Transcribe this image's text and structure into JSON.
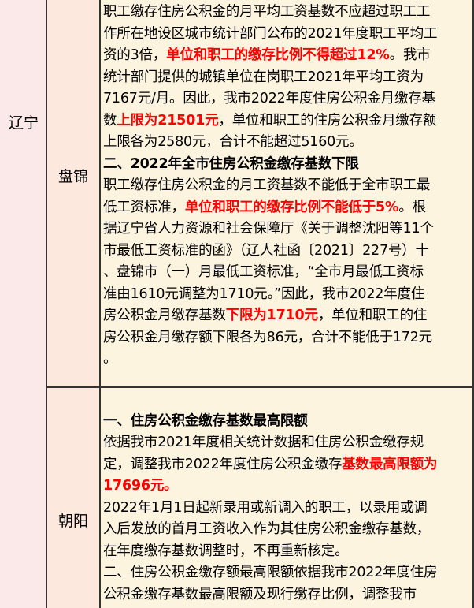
{
  "province": "辽宁",
  "rows": [
    {
      "city": "盘锦",
      "lines": [
        [
          {
            "t": "职工缴存住房公积金的月平均工资基数不应超过职工工"
          }
        ],
        [
          {
            "t": "作所在地设区城市统计部门公布的2021年度职工平均工"
          }
        ],
        [
          {
            "t": "资的3倍，"
          },
          {
            "t": "单位和职工的缴存比例不得超过12%",
            "s": "red"
          },
          {
            "t": "。我市"
          }
        ],
        [
          {
            "t": "统计部门提供的城镇单位在岗职工2021年平均工资为"
          }
        ],
        [
          {
            "t": "7167元/月。因此，我市2022年度住房公积金月缴存基"
          }
        ],
        [
          {
            "t": "数"
          },
          {
            "t": "上限为21501元",
            "s": "red"
          },
          {
            "t": "，单位和职工的住房公积金月缴存额"
          }
        ],
        [
          {
            "t": "上限各为2580元，合计不能超过5160元。"
          }
        ],
        [
          {
            "t": "二、2022年全市住房公积金缴存基数下限",
            "s": "b"
          }
        ],
        [
          {
            "t": "职工缴存住房公积金的月工资基数不能低于全市职工最"
          }
        ],
        [
          {
            "t": "低工资标准，"
          },
          {
            "t": "单位和职工的缴存比例不能低于5%",
            "s": "red"
          },
          {
            "t": "。根"
          }
        ],
        [
          {
            "t": "据辽宁省人力资源和社会保障厅《关于调整沈阳等11个"
          }
        ],
        [
          {
            "t": "市最低工资标准的函》（辽人社函〔2021〕227号）十"
          }
        ],
        [
          {
            "t": "、盘锦市（一）月最低工资标准，“全市月最低工资标"
          }
        ],
        [
          {
            "t": "准由1610元调整为1710元。”因此，我市2022年度住"
          }
        ],
        [
          {
            "t": "房公积金月缴存基数"
          },
          {
            "t": "下限为1710元",
            "s": "red"
          },
          {
            "t": "，单位和职工的住"
          }
        ],
        [
          {
            "t": "房公积金月缴存额下限各为86元，合计不能低于172元"
          }
        ],
        [
          {
            "t": "。"
          }
        ]
      ]
    },
    {
      "city": "朝阳",
      "lines": [
        [
          {
            "t": ""
          }
        ],
        [
          {
            "t": "一、住房公积金缴存基数最高限额",
            "s": "b"
          }
        ],
        [
          {
            "t": "依据我市2021年度相关统计数据和住房公积金缴存规"
          }
        ],
        [
          {
            "t": "定，调整我市2022年度住房公积金缴存"
          },
          {
            "t": "基数最高限额为",
            "s": "red"
          }
        ],
        [
          {
            "t": "17696元。",
            "s": "red"
          }
        ],
        [
          {
            "t": "2022年1月1日起新录用或新调入的职工，以录用或调"
          }
        ],
        [
          {
            "t": "入后发放的首月工资收入作为其住房公积金缴存基数，"
          }
        ],
        [
          {
            "t": "在年度缴存基数调整时，不再重新核定。"
          }
        ],
        [
          {
            "t": "二、住房公积金缴存额最高限额依据我市2022年度住房"
          }
        ],
        [
          {
            "t": "公积金缴存基数最高限额及现行缴存比例，调整我市"
          }
        ]
      ]
    }
  ]
}
